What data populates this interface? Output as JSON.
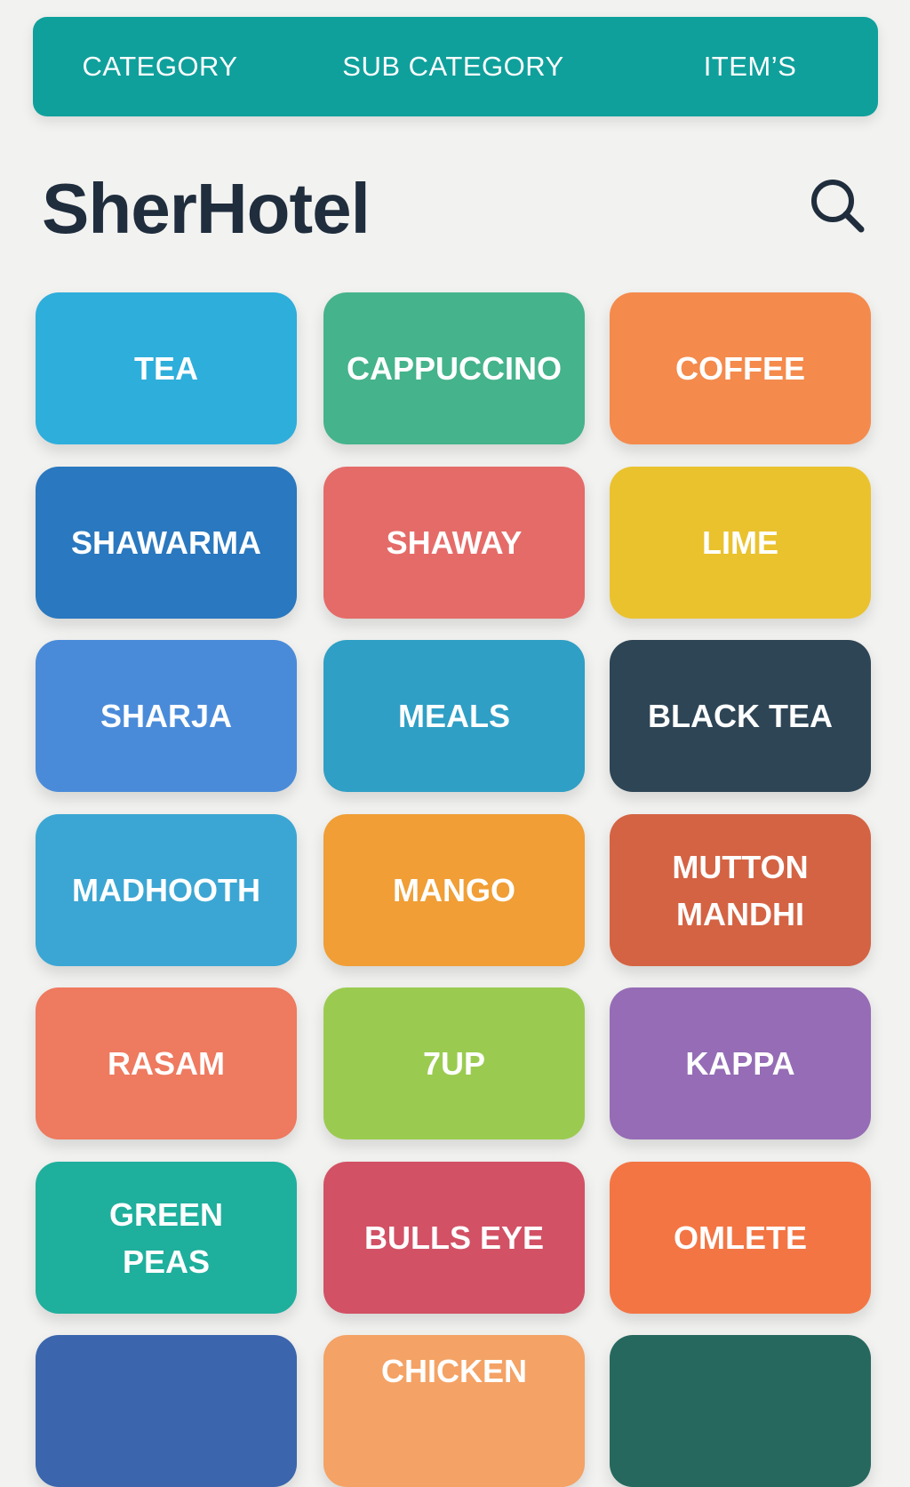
{
  "tabs": [
    {
      "label": "CATEGORY"
    },
    {
      "label": "SUB CATEGORY"
    },
    {
      "label": "ITEM’S"
    }
  ],
  "header": {
    "title": "SherHotel",
    "search_icon": "search-icon"
  },
  "items": [
    {
      "label": "TEA",
      "color": "#2eaedb"
    },
    {
      "label": "CAPPUCCINO",
      "color": "#45b38b"
    },
    {
      "label": "COFFEE",
      "color": "#f48a4c"
    },
    {
      "label": "SHAWARMA",
      "color": "#2a78bf"
    },
    {
      "label": "SHAWAY",
      "color": "#e56b68"
    },
    {
      "label": "LIME",
      "color": "#eac22e"
    },
    {
      "label": "SHARJA",
      "color": "#4a8bd9"
    },
    {
      "label": "MEALS",
      "color": "#2f9fc5"
    },
    {
      "label": "BLACK TEA",
      "color": "#2e4556"
    },
    {
      "label": "MADHOOTH",
      "color": "#3ba6d3"
    },
    {
      "label": "MANGO",
      "color": "#f09e35"
    },
    {
      "label": "MUTTON MANDHI",
      "color": "#d46343"
    },
    {
      "label": "RASAM",
      "color": "#ee7a5f"
    },
    {
      "label": "7UP",
      "color": "#9acb50"
    },
    {
      "label": "KAPPA",
      "color": "#956cb5"
    },
    {
      "label": "GREEN PEAS",
      "color": "#1faf9d"
    },
    {
      "label": "BULLS EYE",
      "color": "#d25165"
    },
    {
      "label": "OMLETE",
      "color": "#f37544"
    },
    {
      "label": "",
      "color": "#3b66ad"
    },
    {
      "label": "CHICKEN",
      "color": "#f4a265"
    },
    {
      "label": "",
      "color": "#26685e"
    }
  ]
}
